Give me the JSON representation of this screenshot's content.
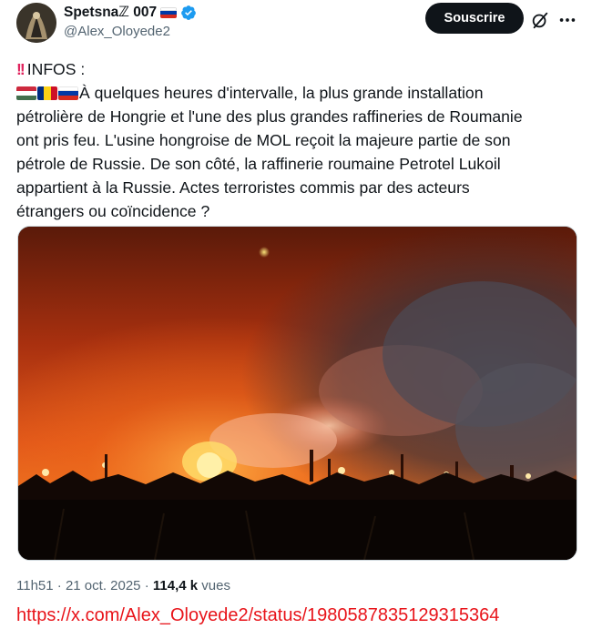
{
  "author": {
    "display_name": "Spetsnaℤ 007",
    "handle": "@Alex_Oloyede2",
    "verified": true
  },
  "actions": {
    "subscribe_label": "Souscrire",
    "grok_icon": "grok-icon",
    "more_icon": "more-icon"
  },
  "tweet": {
    "heading": "INFOS :",
    "lines": [
      "À quelques heures d'intervalle, la plus grande installation",
      "pétrolière de Hongrie et l'une des plus grandes raffineries de Roumanie",
      "ont pris feu. L'usine hongroise de MOL reçoit la majeure partie de son",
      "pétrole de Russie. De son côté, la raffinerie roumaine Petrotel Lukoil",
      "appartient à la Russie. Actes terroristes commis par des acteurs",
      "étrangers ou coïncidence ?"
    ],
    "flags": [
      "hungary-flag",
      "romania-flag",
      "russia-flag"
    ],
    "media_description_icon": "refinery-fire-photo"
  },
  "meta": {
    "time": "11h51",
    "separator": "·",
    "date": "21 oct. 2025",
    "views_count": "114,4 k",
    "views_label": "vues"
  },
  "footer": {
    "url": "https://x.com/Alex_Oloyede2/status/1980587835129315364"
  },
  "colors": {
    "accent": "#0f1419",
    "verified_blue": "#1d9bf0",
    "url_red": "#e8141a",
    "muted": "#536471"
  }
}
